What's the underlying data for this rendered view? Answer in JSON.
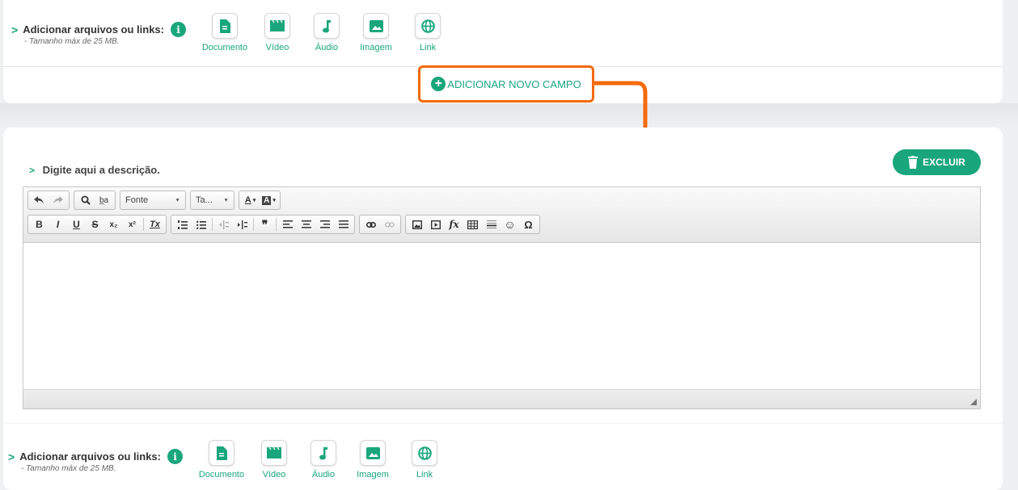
{
  "attachments_top": {
    "label": "Adicionar arquivos ou links:",
    "info_icon": "i",
    "subtitle": "- Tamanho máx de 25 MB.",
    "buttons": [
      {
        "label": "Documento",
        "icon": "document-icon"
      },
      {
        "label": "Vídeo",
        "icon": "video-clapper-icon"
      },
      {
        "label": "Áudio",
        "icon": "music-note-icon"
      },
      {
        "label": "Imagem",
        "icon": "image-icon"
      },
      {
        "label": "Link",
        "icon": "globe-icon"
      }
    ]
  },
  "add_field": {
    "plus": "+",
    "label": "ADICIONAR NOVO CAMPO",
    "highlight_color": "#f56a0c"
  },
  "description": {
    "label": "Digite aqui a descrição.",
    "chevron": ">"
  },
  "delete_button": {
    "label": "EXCLUIR",
    "icon": "trash-icon"
  },
  "editor": {
    "font_combo": "Fonte",
    "size_combo": "Ta...",
    "row1_icons": [
      "undo-icon",
      "redo-icon",
      "find-icon",
      "replace-icon",
      "text-color-icon",
      "background-color-icon"
    ],
    "row2": {
      "bold": "B",
      "italic": "I",
      "underline": "U",
      "strike": "S",
      "subscript": "x₂",
      "superscript": "x²",
      "remove_format": "Tx",
      "quote": "❞",
      "smiley": "☺",
      "omega": "Ω",
      "formula": "fx"
    }
  },
  "attachments_bottom": {
    "label": "Adicionar arquivos ou links:",
    "info_icon": "i",
    "subtitle": "- Tamanho máx de 25 MB.",
    "buttons": [
      {
        "label": "Documento",
        "icon": "document-icon"
      },
      {
        "label": "Vídeo",
        "icon": "video-clapper-icon"
      },
      {
        "label": "Áudio",
        "icon": "music-note-icon"
      },
      {
        "label": "Imagem",
        "icon": "image-icon"
      },
      {
        "label": "Link",
        "icon": "globe-icon"
      }
    ]
  },
  "colors": {
    "accent": "#1aa67c",
    "highlight": "#f56a0c"
  }
}
